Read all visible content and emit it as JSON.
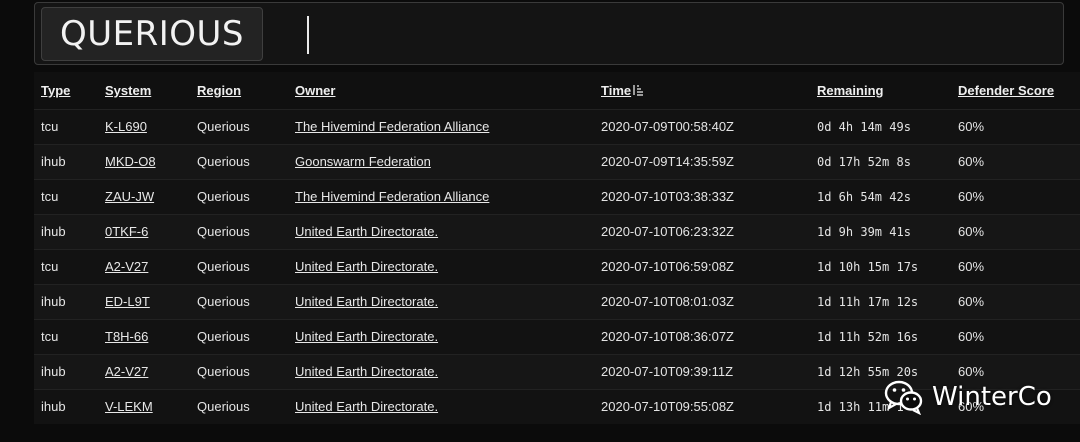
{
  "search": {
    "query_chip": "QUERIOUS"
  },
  "table": {
    "headers": {
      "type": "Type",
      "system": "System",
      "region": "Region",
      "owner": "Owner",
      "time": "Time",
      "remaining": "Remaining",
      "defender_score": "Defender Score"
    },
    "sort_column": "time",
    "sort_icon": "sort-ascending-icon",
    "rows": [
      {
        "type": "tcu",
        "system": "K-L690",
        "region": "Querious",
        "owner": "The Hivemind Federation Alliance",
        "time": "2020-07-09T00:58:40Z",
        "remaining": "0d 4h 14m 49s",
        "score": "60%"
      },
      {
        "type": "ihub",
        "system": "MKD-O8",
        "region": "Querious",
        "owner": "Goonswarm Federation",
        "time": "2020-07-09T14:35:59Z",
        "remaining": "0d 17h 52m 8s",
        "score": "60%"
      },
      {
        "type": "tcu",
        "system": "ZAU-JW",
        "region": "Querious",
        "owner": "The Hivemind Federation Alliance",
        "time": "2020-07-10T03:38:33Z",
        "remaining": "1d 6h 54m 42s",
        "score": "60%"
      },
      {
        "type": "ihub",
        "system": "0TKF-6",
        "region": "Querious",
        "owner": "United Earth Directorate.",
        "time": "2020-07-10T06:23:32Z",
        "remaining": "1d 9h 39m 41s",
        "score": "60%"
      },
      {
        "type": "tcu",
        "system": "A2-V27",
        "region": "Querious",
        "owner": "United Earth Directorate.",
        "time": "2020-07-10T06:59:08Z",
        "remaining": "1d 10h 15m 17s",
        "score": "60%"
      },
      {
        "type": "ihub",
        "system": "ED-L9T",
        "region": "Querious",
        "owner": "United Earth Directorate.",
        "time": "2020-07-10T08:01:03Z",
        "remaining": "1d 11h 17m 12s",
        "score": "60%"
      },
      {
        "type": "tcu",
        "system": "T8H-66",
        "region": "Querious",
        "owner": "United Earth Directorate.",
        "time": "2020-07-10T08:36:07Z",
        "remaining": "1d 11h 52m 16s",
        "score": "60%"
      },
      {
        "type": "ihub",
        "system": "A2-V27",
        "region": "Querious",
        "owner": "United Earth Directorate.",
        "time": "2020-07-10T09:39:11Z",
        "remaining": "1d 12h 55m 20s",
        "score": "60%"
      },
      {
        "type": "ihub",
        "system": "V-LEKM",
        "region": "Querious",
        "owner": "United Earth Directorate.",
        "time": "2020-07-10T09:55:08Z",
        "remaining": "1d 13h 11m 1",
        "score": "60%"
      }
    ]
  },
  "watermark": {
    "icon": "wechat-icon",
    "text": "WinterCo"
  }
}
